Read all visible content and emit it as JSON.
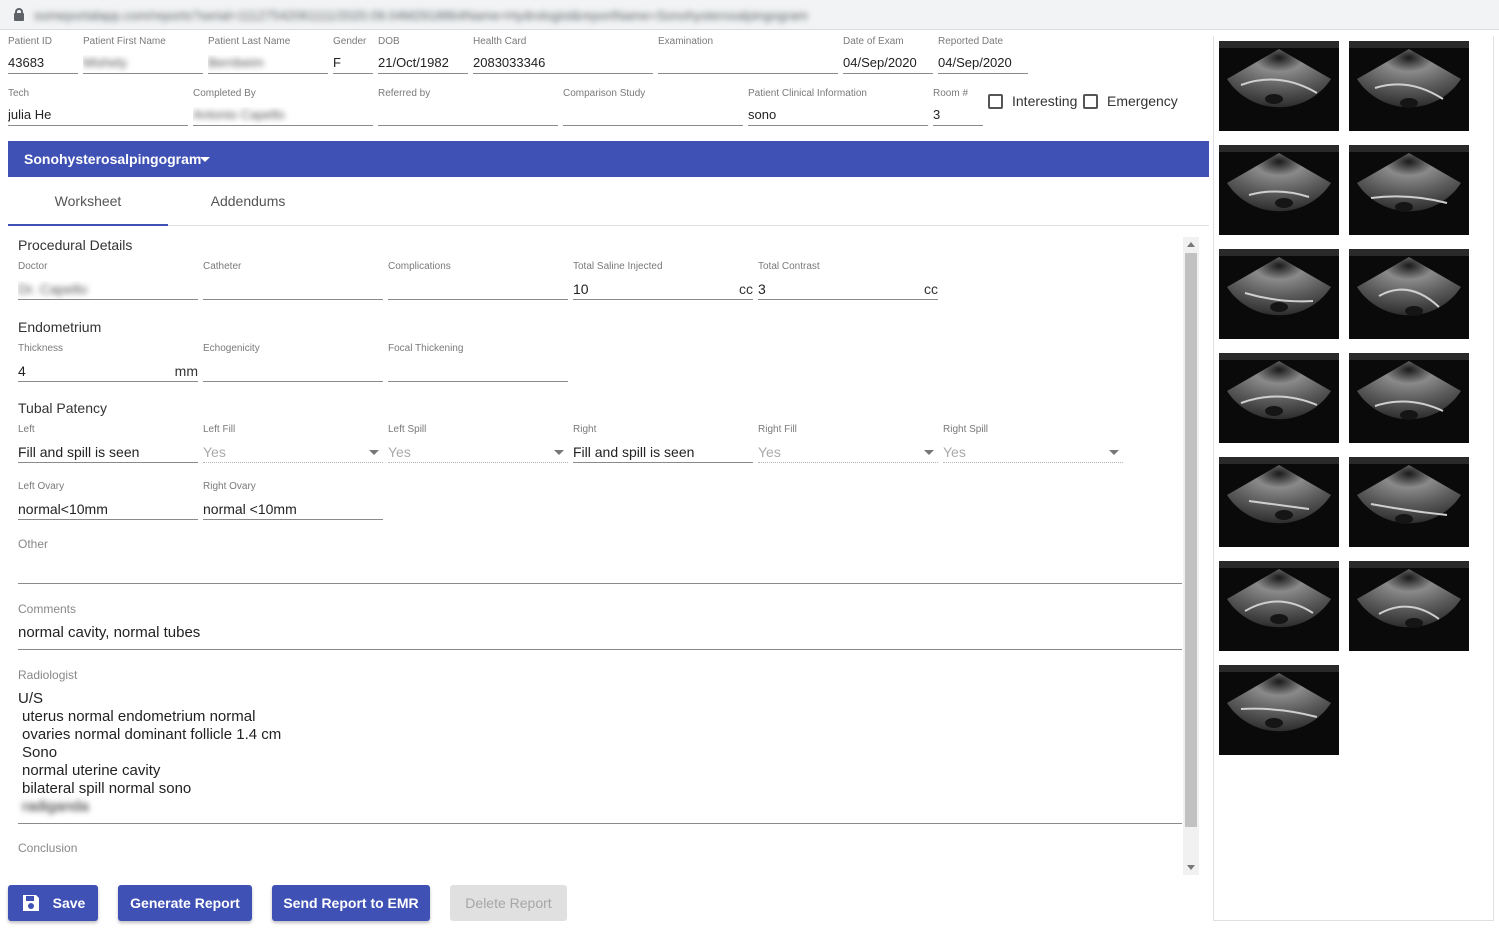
{
  "browser": {
    "url": "someportalapp.com/reports?serial=11127542061111/2020.09.04M2918864Name=Hydrologist&reportName=Sonohysterosalpingogram"
  },
  "header": {
    "patient_id": {
      "label": "Patient ID",
      "value": "43683"
    },
    "first_name": {
      "label": "Patient First Name",
      "value": "Mishely"
    },
    "last_name": {
      "label": "Patient Last Name",
      "value": "Bernbeim"
    },
    "gender": {
      "label": "Gender",
      "value": "F"
    },
    "dob": {
      "label": "DOB",
      "value": "21/Oct/1982"
    },
    "health_card": {
      "label": "Health Card",
      "value": "2083033346"
    },
    "examination": {
      "label": "Examination",
      "value": ""
    },
    "date_of_exam": {
      "label": "Date of Exam",
      "value": "04/Sep/2020"
    },
    "reported_date": {
      "label": "Reported Date",
      "value": "04/Sep/2020"
    },
    "tech": {
      "label": "Tech",
      "value": "julia  He"
    },
    "completed_by": {
      "label": "Completed By",
      "value": "Antonio Capello"
    },
    "referred_by": {
      "label": "Referred by",
      "value": ""
    },
    "comparison_study": {
      "label": "Comparison Study",
      "value": ""
    },
    "clinical_info": {
      "label": "Patient Clinical Information",
      "value": "sono"
    },
    "room": {
      "label": "Room #",
      "value": "3"
    },
    "interesting": "Interesting",
    "emergency": "Emergency"
  },
  "exam_bar": {
    "title": "Sonohysterosalpingogram"
  },
  "tabs": [
    {
      "label": "Worksheet"
    },
    {
      "label": "Addendums"
    }
  ],
  "worksheet": {
    "procedural": {
      "title": "Procedural Details",
      "doctor": {
        "label": "Doctor",
        "value": "Dr. Capello"
      },
      "catheter": {
        "label": "Catheter",
        "value": ""
      },
      "complications": {
        "label": "Complications",
        "value": ""
      },
      "saline": {
        "label": "Total Saline Injected",
        "value": "10",
        "unit": "cc"
      },
      "contrast": {
        "label": "Total Contrast",
        "value": "3",
        "unit": "cc"
      }
    },
    "endometrium": {
      "title": "Endometrium",
      "thickness": {
        "label": "Thickness",
        "value": "4",
        "unit": "mm"
      },
      "echogenicity": {
        "label": "Echogenicity",
        "value": ""
      },
      "focal": {
        "label": "Focal Thickening",
        "value": ""
      }
    },
    "tubal": {
      "title": "Tubal Patency",
      "left": {
        "label": "Left",
        "value": "Fill and spill is seen"
      },
      "left_fill": {
        "label": "Left Fill",
        "value": "Yes"
      },
      "left_spill": {
        "label": "Left Spill",
        "value": "Yes"
      },
      "right": {
        "label": "Right",
        "value": "Fill and spill is seen"
      },
      "right_fill": {
        "label": "Right Fill",
        "value": "Yes"
      },
      "right_spill": {
        "label": "Right Spill",
        "value": "Yes"
      }
    },
    "ovaries": {
      "left": {
        "label": "Left Ovary",
        "value": "normal<10mm"
      },
      "right": {
        "label": "Right Ovary",
        "value": "normal <10mm"
      }
    },
    "other": {
      "label": "Other",
      "value": ""
    },
    "comments": {
      "label": "Comments",
      "value": "normal cavity, normal tubes"
    },
    "radiologist": {
      "label": "Radiologist",
      "lines": [
        "U/S",
        "uterus normal endometrium normal",
        "ovaries normal dominant follicle 1.4 cm",
        "Sono",
        "normal uterine cavity",
        "bilateral spill normal sono",
        "radiganda"
      ]
    },
    "conclusion": {
      "label": "Conclusion",
      "value": ""
    }
  },
  "actions": {
    "save": "Save",
    "generate": "Generate Report",
    "send": "Send Report to EMR",
    "delete": "Delete Report"
  }
}
